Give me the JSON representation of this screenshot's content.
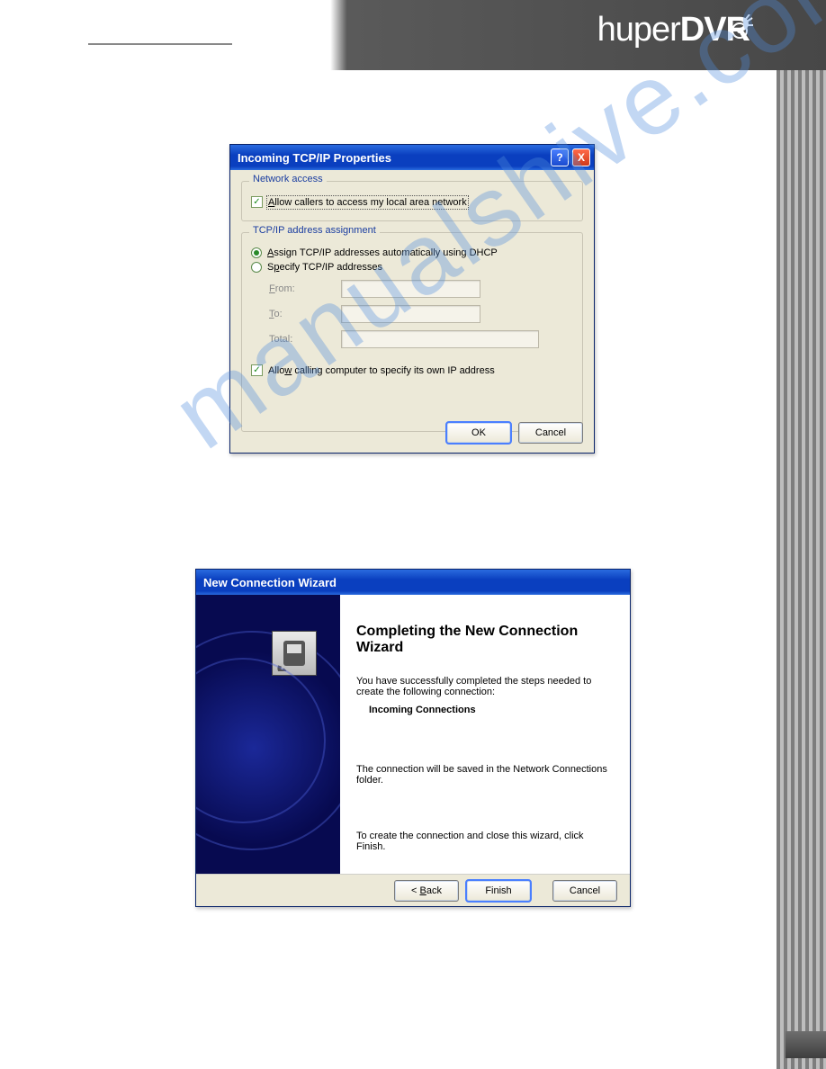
{
  "logo": {
    "text_thin": "huper",
    "text_bold": "DVR"
  },
  "watermark": "manualshive.com",
  "dialog1": {
    "title": "Incoming TCP/IP Properties",
    "help_btn": "?",
    "close_btn": "X",
    "group_network": {
      "legend": "Network access",
      "allow_callers": "Allow callers to access my local area network"
    },
    "group_tcpip": {
      "legend": "TCP/IP address assignment",
      "opt_dhcp": "Assign TCP/IP addresses automatically using DHCP",
      "opt_specify": "Specify TCP/IP addresses",
      "from_label": "From:",
      "to_label": "To:",
      "total_label": "Total:",
      "allow_specify_ip": "Allow calling computer to specify its own IP address"
    },
    "buttons": {
      "ok": "OK",
      "cancel": "Cancel"
    }
  },
  "dialog2": {
    "title": "New Connection Wizard",
    "heading": "Completing the New Connection Wizard",
    "completed_text": "You have successfully completed the steps needed to create the following connection:",
    "connection_name": "Incoming Connections",
    "saved_text": "The connection will be saved in the Network Connections folder.",
    "create_text": "To create the connection and close this wizard, click Finish.",
    "buttons": {
      "back": "< Back",
      "finish": "Finish",
      "cancel": "Cancel"
    }
  }
}
